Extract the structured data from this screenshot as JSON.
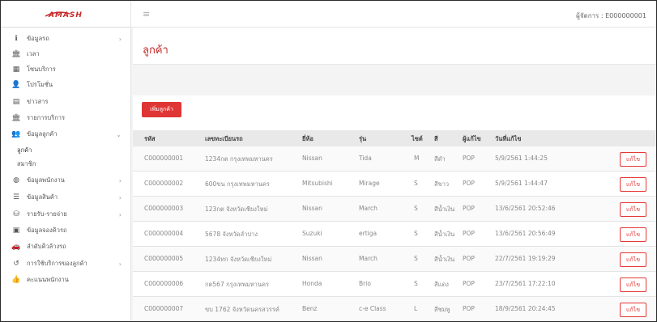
{
  "header": {
    "logo": "AMASH",
    "manager_label": "ผู้จัดการ : E000000001"
  },
  "sidebar": {
    "items": [
      {
        "label": "ข้อมูลรถ",
        "icon": "info-icon",
        "arrow": true
      },
      {
        "label": "เวลา",
        "icon": "bank-icon",
        "arrow": false
      },
      {
        "label": "โซนบริการ",
        "icon": "grid-icon",
        "arrow": false
      },
      {
        "label": "โปรโมชั่น",
        "icon": "user-plus-icon",
        "arrow": false
      },
      {
        "label": "ข่าวสาร",
        "icon": "newspaper-icon",
        "arrow": false
      },
      {
        "label": "รายการบริการ",
        "icon": "bank-icon",
        "arrow": false
      },
      {
        "label": "ข้อมูลลูกค้า",
        "icon": "users-icon",
        "arrow": true,
        "expanded": true
      },
      {
        "label": "ข้อมูลพนักงาน",
        "icon": "globe-icon",
        "arrow": true
      },
      {
        "label": "ข้อมูลสินค้า",
        "icon": "list-icon",
        "arrow": true
      },
      {
        "label": "รายรับ-รายจ่าย",
        "icon": "coins-icon",
        "arrow": true
      },
      {
        "label": "ข้อมูลจองคิวรถ",
        "icon": "calendar-icon",
        "arrow": false
      },
      {
        "label": "ลำดับคิวล้างรถ",
        "icon": "car-icon",
        "arrow": false
      },
      {
        "label": "การใช้บริการของลูกค้า",
        "icon": "history-icon",
        "arrow": true
      },
      {
        "label": "คะแนนพนักงาน",
        "icon": "thumbs-up-icon",
        "arrow": false
      }
    ],
    "sub_items": [
      "ลูกค้า",
      "สมาชิก"
    ]
  },
  "page": {
    "title": "ลูกค้า",
    "add_button": "เพิ่มลูกค้า"
  },
  "table": {
    "headers": [
      "รหัส",
      "เลขทะเบียนรถ",
      "ยี่ห้อ",
      "รุ่น",
      "ไซต์",
      "สี",
      "ผู้แก้ไข",
      "วันที่แก้ไข"
    ],
    "edit_label": "แก้ไข",
    "rows": [
      [
        "C000000001",
        "1234กต กรุงเทพมหานคร",
        "Nissan",
        "Tida",
        "M",
        "สีดำ",
        "POP",
        "5/9/2561 1:44:25"
      ],
      [
        "C000000002",
        "600ขน กรุงเทพมหานคร",
        "Mitsubishi",
        "Mirage",
        "S",
        "สีขาว",
        "POP",
        "5/9/2561 1:44:47"
      ],
      [
        "C000000003",
        "123กต จังหวัดเชียงใหม่",
        "Nissan",
        "March",
        "S",
        "สีน้ำเงิน",
        "POP",
        "13/6/2561 20:52:46"
      ],
      [
        "C000000004",
        "5678 จังหวัดลำปาง",
        "Suzuki",
        "ertiga",
        "S",
        "สีน้ำเงิน",
        "POP",
        "13/6/2561 20:56:49"
      ],
      [
        "C000000005",
        "1234ทก จังหวัดเชียงใหม่",
        "Nissan",
        "March",
        "S",
        "สีน้ำเงิน",
        "POP",
        "22/7/2561 19:19:29"
      ],
      [
        "C000000006",
        "กต567 กรุงเทพมหานคร",
        "Honda",
        "Brio",
        "S",
        "สีแดง",
        "POP",
        "23/7/2561 17:22:10"
      ],
      [
        "C000000007",
        "ขบ 1762 จังหวัดนครสวรรค์",
        "Benz",
        "c-e Class",
        "L",
        "สีชมพู",
        "POP",
        "18/9/2561 20:24:45"
      ]
    ]
  },
  "colors": {
    "accent": "#e03535",
    "title": "#c62828",
    "active_icon": "#3b6fb6"
  }
}
